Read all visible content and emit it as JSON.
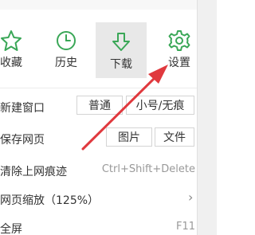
{
  "toolbar": {
    "favorites_label": "收藏",
    "history_label": "历史",
    "download_label": "下载",
    "settings_label": "设置"
  },
  "menu": {
    "new_window": {
      "label": "新建窗口",
      "normal_label": "普通",
      "incognito_label": "小号/无痕"
    },
    "save_page": {
      "label": "保存网页",
      "image_label": "图片",
      "file_label": "文件"
    },
    "clear_traces": {
      "label": "清除上网痕迹",
      "shortcut": "Ctrl+Shift+Delete"
    },
    "zoom": {
      "label": "网页缩放（125%）",
      "chevron": "›"
    },
    "fullscreen": {
      "label": "全屏",
      "shortcut": "F11"
    }
  },
  "colors": {
    "accent_green": "#3aa757",
    "annotation_red": "#e0393e",
    "active_bg": "#e8e8e8"
  },
  "icons": [
    "star-icon",
    "clock-icon",
    "download-arrow-icon",
    "gear-icon",
    "chevron-right-icon"
  ]
}
